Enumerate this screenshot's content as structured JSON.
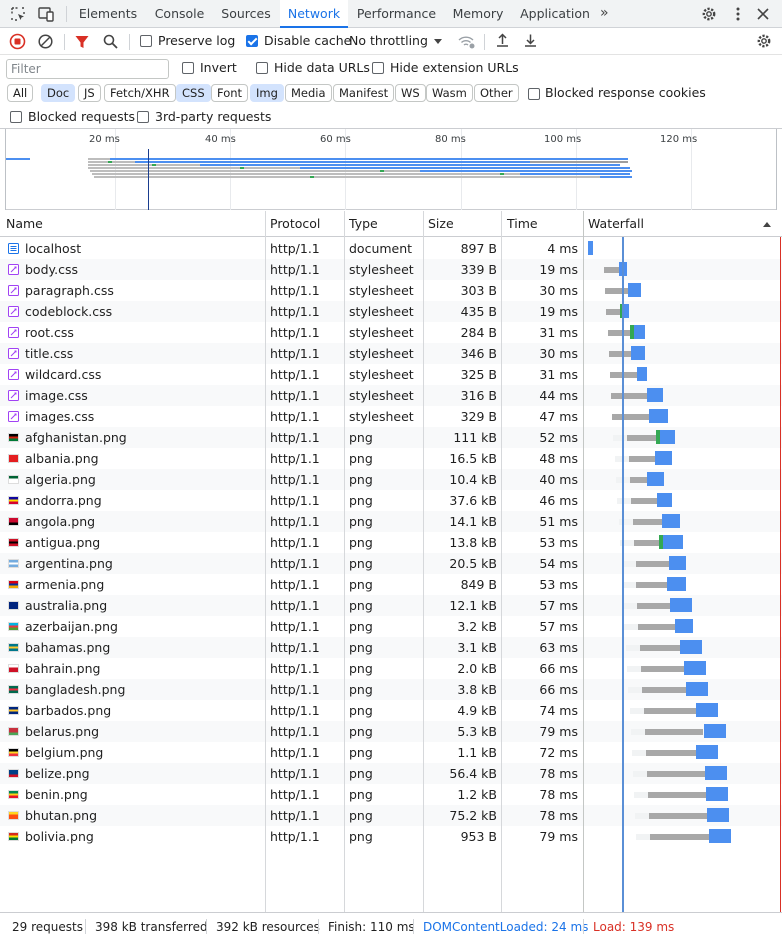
{
  "tabs": [
    "Elements",
    "Console",
    "Sources",
    "Network",
    "Performance",
    "Memory",
    "Application"
  ],
  "active_tab": "Network",
  "toolbar": {
    "preserve_log": "Preserve log",
    "disable_cache": "Disable cache",
    "throttling": "No throttling"
  },
  "filter": {
    "placeholder": "Filter",
    "invert": "Invert",
    "hide_data_urls": "Hide data URLs",
    "hide_extension_urls": "Hide extension URLs",
    "blocked_response_cookies": "Blocked response cookies",
    "blocked_requests": "Blocked requests",
    "third_party": "3rd-party requests"
  },
  "type_chips": [
    {
      "label": "All",
      "selected": false
    },
    {
      "label": "Doc",
      "selected": true
    },
    {
      "label": "JS",
      "selected": false
    },
    {
      "label": "Fetch/XHR",
      "selected": false
    },
    {
      "label": "CSS",
      "selected": true
    },
    {
      "label": "Font",
      "selected": false
    },
    {
      "label": "Img",
      "selected": true
    },
    {
      "label": "Media",
      "selected": false
    },
    {
      "label": "Manifest",
      "selected": false
    },
    {
      "label": "WS",
      "selected": false
    },
    {
      "label": "Wasm",
      "selected": false
    },
    {
      "label": "Other",
      "selected": false
    }
  ],
  "overview_ticks": [
    "20 ms",
    "40 ms",
    "60 ms",
    "80 ms",
    "100 ms",
    "120 ms"
  ],
  "columns": {
    "name": "Name",
    "protocol": "Protocol",
    "type": "Type",
    "size": "Size",
    "time": "Time",
    "waterfall": "Waterfall"
  },
  "requests": [
    {
      "name": "localhost",
      "protocol": "http/1.1",
      "type": "document",
      "size": "897 B",
      "time": "4 ms",
      "kind": "doc"
    },
    {
      "name": "body.css",
      "protocol": "http/1.1",
      "type": "stylesheet",
      "size": "339 B",
      "time": "19 ms",
      "kind": "css"
    },
    {
      "name": "paragraph.css",
      "protocol": "http/1.1",
      "type": "stylesheet",
      "size": "303 B",
      "time": "30 ms",
      "kind": "css"
    },
    {
      "name": "codeblock.css",
      "protocol": "http/1.1",
      "type": "stylesheet",
      "size": "435 B",
      "time": "19 ms",
      "kind": "css"
    },
    {
      "name": "root.css",
      "protocol": "http/1.1",
      "type": "stylesheet",
      "size": "284 B",
      "time": "31 ms",
      "kind": "css"
    },
    {
      "name": "title.css",
      "protocol": "http/1.1",
      "type": "stylesheet",
      "size": "346 B",
      "time": "30 ms",
      "kind": "css"
    },
    {
      "name": "wildcard.css",
      "protocol": "http/1.1",
      "type": "stylesheet",
      "size": "325 B",
      "time": "31 ms",
      "kind": "css"
    },
    {
      "name": "image.css",
      "protocol": "http/1.1",
      "type": "stylesheet",
      "size": "316 B",
      "time": "44 ms",
      "kind": "css"
    },
    {
      "name": "images.css",
      "protocol": "http/1.1",
      "type": "stylesheet",
      "size": "329 B",
      "time": "47 ms",
      "kind": "css"
    },
    {
      "name": "afghanistan.png",
      "protocol": "http/1.1",
      "type": "png",
      "size": "111 kB",
      "time": "52 ms",
      "kind": "img",
      "flag": [
        "#000",
        "#d32011",
        "#007a36"
      ]
    },
    {
      "name": "albania.png",
      "protocol": "http/1.1",
      "type": "png",
      "size": "16.5 kB",
      "time": "48 ms",
      "kind": "img",
      "flag": [
        "#e41e20",
        "#e41e20",
        "#e41e20"
      ]
    },
    {
      "name": "algeria.png",
      "protocol": "http/1.1",
      "type": "png",
      "size": "10.4 kB",
      "time": "40 ms",
      "kind": "img",
      "flag": [
        "#006233",
        "#fff",
        "#fff"
      ]
    },
    {
      "name": "andorra.png",
      "protocol": "http/1.1",
      "type": "png",
      "size": "37.6 kB",
      "time": "46 ms",
      "kind": "img",
      "flag": [
        "#10069f",
        "#fedd00",
        "#d50032"
      ]
    },
    {
      "name": "angola.png",
      "protocol": "http/1.1",
      "type": "png",
      "size": "14.1 kB",
      "time": "51 ms",
      "kind": "img",
      "flag": [
        "#cc092f",
        "#cc092f",
        "#000"
      ]
    },
    {
      "name": "antigua.png",
      "protocol": "http/1.1",
      "type": "png",
      "size": "13.8 kB",
      "time": "53 ms",
      "kind": "img",
      "flag": [
        "#ce1126",
        "#000",
        "#ce1126"
      ]
    },
    {
      "name": "argentina.png",
      "protocol": "http/1.1",
      "type": "png",
      "size": "20.5 kB",
      "time": "54 ms",
      "kind": "img",
      "flag": [
        "#74acdf",
        "#fff",
        "#74acdf"
      ]
    },
    {
      "name": "armenia.png",
      "protocol": "http/1.1",
      "type": "png",
      "size": "849 B",
      "time": "53 ms",
      "kind": "img",
      "flag": [
        "#d90012",
        "#0033a0",
        "#f2a800"
      ]
    },
    {
      "name": "australia.png",
      "protocol": "http/1.1",
      "type": "png",
      "size": "12.1 kB",
      "time": "57 ms",
      "kind": "img",
      "flag": [
        "#00247d",
        "#00247d",
        "#00247d"
      ]
    },
    {
      "name": "azerbaijan.png",
      "protocol": "http/1.1",
      "type": "png",
      "size": "3.2 kB",
      "time": "57 ms",
      "kind": "img",
      "flag": [
        "#00b5e2",
        "#ef3340",
        "#509e2f"
      ]
    },
    {
      "name": "bahamas.png",
      "protocol": "http/1.1",
      "type": "png",
      "size": "3.1 kB",
      "time": "63 ms",
      "kind": "img",
      "flag": [
        "#00778b",
        "#ffc72c",
        "#00778b"
      ]
    },
    {
      "name": "bahrain.png",
      "protocol": "http/1.1",
      "type": "png",
      "size": "2.0 kB",
      "time": "66 ms",
      "kind": "img",
      "flag": [
        "#fff",
        "#ce1126",
        "#ce1126"
      ]
    },
    {
      "name": "bangladesh.png",
      "protocol": "http/1.1",
      "type": "png",
      "size": "3.8 kB",
      "time": "66 ms",
      "kind": "img",
      "flag": [
        "#006a4e",
        "#f42a41",
        "#006a4e"
      ]
    },
    {
      "name": "barbados.png",
      "protocol": "http/1.1",
      "type": "png",
      "size": "4.9 kB",
      "time": "74 ms",
      "kind": "img",
      "flag": [
        "#00267f",
        "#ffc726",
        "#00267f"
      ]
    },
    {
      "name": "belarus.png",
      "protocol": "http/1.1",
      "type": "png",
      "size": "5.3 kB",
      "time": "79 ms",
      "kind": "img",
      "flag": [
        "#c8313e",
        "#c8313e",
        "#4aa657"
      ]
    },
    {
      "name": "belgium.png",
      "protocol": "http/1.1",
      "type": "png",
      "size": "1.1 kB",
      "time": "72 ms",
      "kind": "img",
      "flag": [
        "#000",
        "#fdda24",
        "#ef3340"
      ]
    },
    {
      "name": "belize.png",
      "protocol": "http/1.1",
      "type": "png",
      "size": "56.4 kB",
      "time": "78 ms",
      "kind": "img",
      "flag": [
        "#003f87",
        "#003f87",
        "#ce1126"
      ]
    },
    {
      "name": "benin.png",
      "protocol": "http/1.1",
      "type": "png",
      "size": "1.2 kB",
      "time": "78 ms",
      "kind": "img",
      "flag": [
        "#008751",
        "#fcd116",
        "#e8112d"
      ]
    },
    {
      "name": "bhutan.png",
      "protocol": "http/1.1",
      "type": "png",
      "size": "75.2 kB",
      "time": "78 ms",
      "kind": "img",
      "flag": [
        "#ffd520",
        "#ff4e12",
        "#ff4e12"
      ]
    },
    {
      "name": "bolivia.png",
      "protocol": "http/1.1",
      "type": "png",
      "size": "953 B",
      "time": "79 ms",
      "kind": "img",
      "flag": [
        "#d52b1e",
        "#f9e300",
        "#007934"
      ]
    }
  ],
  "status": {
    "requests": "29 requests",
    "transferred": "398 kB transferred",
    "resources": "392 kB resources",
    "finish": "Finish: 110 ms",
    "dcl": "DOMContentLoaded: 24 ms",
    "load": "Load: 139 ms"
  },
  "colors": {
    "accent": "#1a73e8",
    "dcl": "#1a73e8",
    "load": "#d93025",
    "wait": "#9e9e9e",
    "download": "#4c8ff0"
  }
}
